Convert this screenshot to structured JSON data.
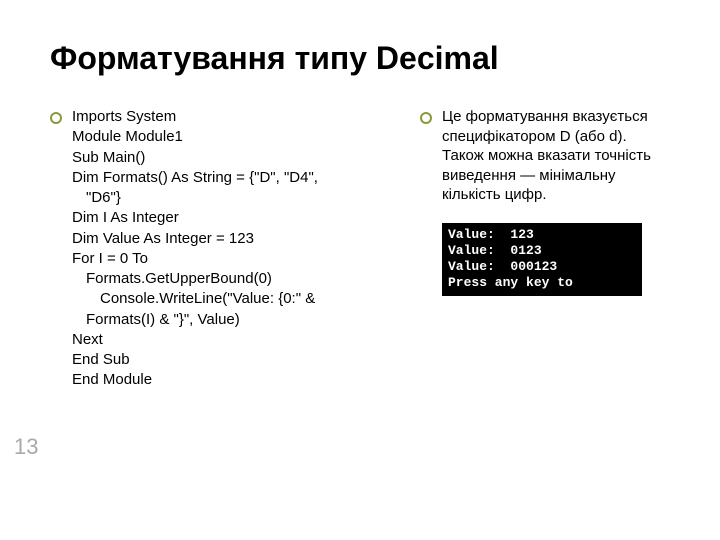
{
  "title": "Форматування типу Decimal",
  "code": {
    "l1": "Imports System",
    "l2": "Module Module1",
    "l3": "Sub Main()",
    "l4": "Dim Formats() As String = {\"D\", \"D4\",",
    "l4b": "\"D6\"}",
    "l5": "Dim I As Integer",
    "l6": "Dim Value As Integer = 123",
    "l7": "For I = 0 To",
    "l7b": "Formats.GetUpperBound(0)",
    "l8": "Console.WriteLine(\"Value: {0:\" &",
    "l8b": "Formats(I) & \"}\", Value)",
    "l9": "Next",
    "l10": "End Sub",
    "l11": "End Module"
  },
  "description": "Це форматування вказується специфікатором D (або d). Також можна вказати точність виведення — мінімальну кількість цифр.",
  "console": "Value:  123\nValue:  0123\nValue:  000123\nPress any key to",
  "page_number": "13"
}
